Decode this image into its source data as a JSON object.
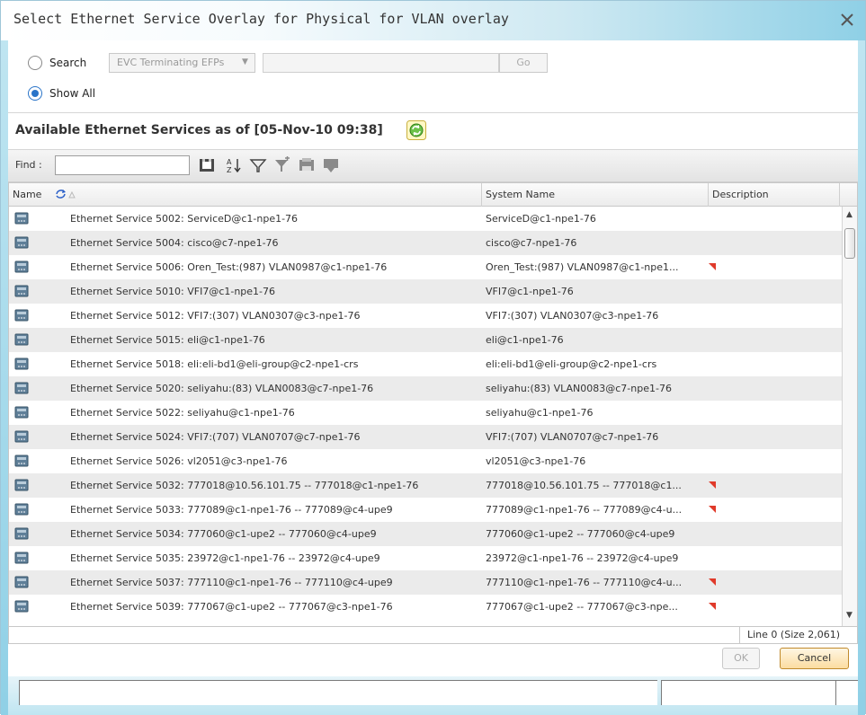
{
  "dialog": {
    "title": "Select Ethernet Service Overlay for Physical for VLAN overlay"
  },
  "search": {
    "search_label": "Search",
    "filter_selected": "EVC Terminating EFPs",
    "search_value": "",
    "go_label": "Go",
    "show_all_label": "Show All",
    "selected_option": "Show All"
  },
  "available": {
    "title": "Available Ethernet Services as of [05-Nov-10 09:38]"
  },
  "toolbar": {
    "find_label": "Find :",
    "find_value": "",
    "icons": [
      "export-icon",
      "sort-az-icon",
      "filter-icon",
      "advanced-filter-icon",
      "print-icon",
      "column-settings-icon"
    ]
  },
  "grid": {
    "columns": [
      "Name",
      "System Name",
      "Description"
    ],
    "rows": [
      {
        "name": "Ethernet Service 5002: ServiceD@c1-npe1-76",
        "system": "ServiceD@c1-npe1-76",
        "truncated": false
      },
      {
        "name": "Ethernet Service 5004: cisco@c7-npe1-76",
        "system": "cisco@c7-npe1-76",
        "truncated": false
      },
      {
        "name": "Ethernet Service 5006: Oren_Test:(987) VLAN0987@c1-npe1-76",
        "system": "Oren_Test:(987) VLAN0987@c1-npe1...",
        "truncated": true
      },
      {
        "name": "Ethernet Service 5010: VFI7@c1-npe1-76",
        "system": "VFI7@c1-npe1-76",
        "truncated": false
      },
      {
        "name": "Ethernet Service 5012: VFI7:(307) VLAN0307@c3-npe1-76",
        "system": "VFI7:(307) VLAN0307@c3-npe1-76",
        "truncated": false
      },
      {
        "name": "Ethernet Service 5015: eli@c1-npe1-76",
        "system": "eli@c1-npe1-76",
        "truncated": false
      },
      {
        "name": "Ethernet Service 5018: eli:eli-bd1@eli-group@c2-npe1-crs",
        "system": "eli:eli-bd1@eli-group@c2-npe1-crs",
        "truncated": false
      },
      {
        "name": "Ethernet Service 5020: seliyahu:(83) VLAN0083@c7-npe1-76",
        "system": "seliyahu:(83) VLAN0083@c7-npe1-76",
        "truncated": false
      },
      {
        "name": "Ethernet Service 5022: seliyahu@c1-npe1-76",
        "system": "seliyahu@c1-npe1-76",
        "truncated": false
      },
      {
        "name": "Ethernet Service 5024: VFI7:(707) VLAN0707@c7-npe1-76",
        "system": "VFI7:(707) VLAN0707@c7-npe1-76",
        "truncated": false
      },
      {
        "name": "Ethernet Service 5026: vl2051@c3-npe1-76",
        "system": "vl2051@c3-npe1-76",
        "truncated": false
      },
      {
        "name": "Ethernet Service 5032: 777018@10.56.101.75 -- 777018@c1-npe1-76",
        "system": "777018@10.56.101.75 -- 777018@c1...",
        "truncated": true
      },
      {
        "name": "Ethernet Service 5033: 777089@c1-npe1-76 -- 777089@c4-upe9",
        "system": "777089@c1-npe1-76 -- 777089@c4-u...",
        "truncated": true
      },
      {
        "name": "Ethernet Service 5034: 777060@c1-upe2 -- 777060@c4-upe9",
        "system": "777060@c1-upe2 -- 777060@c4-upe9",
        "truncated": false
      },
      {
        "name": "Ethernet Service 5035: 23972@c1-npe1-76 -- 23972@c4-upe9",
        "system": "23972@c1-npe1-76 -- 23972@c4-upe9",
        "truncated": false
      },
      {
        "name": "Ethernet Service 5037: 777110@c1-npe1-76 -- 777110@c4-upe9",
        "system": "777110@c1-npe1-76 -- 777110@c4-u...",
        "truncated": true
      },
      {
        "name": "Ethernet Service 5039: 777067@c1-upe2 -- 777067@c3-npe1-76",
        "system": "777067@c1-upe2 -- 777067@c3-npe...",
        "truncated": true
      }
    ]
  },
  "status": {
    "line_info": "Line 0 (Size 2,061)"
  },
  "buttons": {
    "ok_label": "OK",
    "cancel_label": "Cancel"
  },
  "colors": {
    "title_accent": "#8fd0e6",
    "refresh_green": "#4caf2a",
    "selected_radio": "#2a74c8",
    "cancel_button": "#fbdca0"
  }
}
